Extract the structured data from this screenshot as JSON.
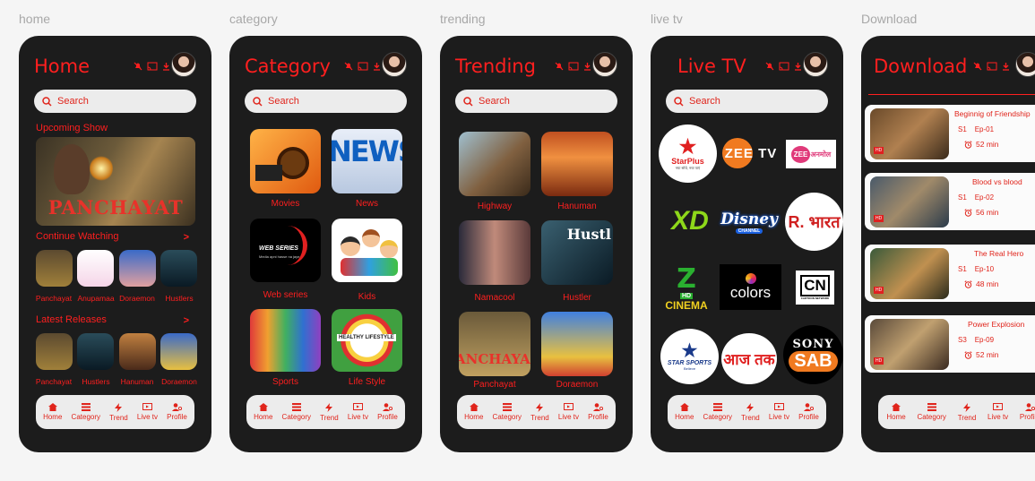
{
  "frames": [
    "home",
    "category",
    "trending",
    "live tv",
    "Download"
  ],
  "screens": {
    "home": {
      "title": "Home"
    },
    "category": {
      "title": "Category"
    },
    "trending": {
      "title": "Trending"
    },
    "livetv": {
      "title": "Live TV"
    },
    "download": {
      "title": "Download"
    }
  },
  "search": {
    "placeholder": "Search"
  },
  "home": {
    "upcoming_label": "Upcoming Show",
    "upcoming_banner_text": "PANCHAYAT",
    "continue_label": "Continue Watching",
    "continue_items": [
      "Panchayat",
      "Anupamaa",
      "Doraemon",
      "Hustlers"
    ],
    "latest_label": "Latest Releases",
    "latest_items": [
      "Panchayat",
      "Hustlers",
      "Hanuman",
      "Doraemon"
    ],
    "chevron": ">"
  },
  "category": {
    "items": [
      "Movies",
      "News",
      "Web series",
      "Kids",
      "Sports",
      "Life Style"
    ],
    "thumb_texts": {
      "news": "NEWS",
      "web": "WEB SERIES",
      "web_sub": "Media apni hasse na jaye",
      "life": "HEALTHY LIFESTYLE"
    }
  },
  "trending": {
    "items": [
      "Highway",
      "Hanuman",
      "Namacool",
      "Hustler",
      "Panchayat",
      "Doraemon"
    ],
    "thumb_texts": {
      "hustle": "Hustl",
      "panch": "ANCHAYA"
    }
  },
  "livetv": {
    "channels": {
      "starplus": "StarPlus",
      "starplus_tag": "नया सोचे, नया पाएं",
      "zeetv": "ZEE TV",
      "zee_a": "ZEE",
      "zee_b": "अनमोल",
      "xd": "XD",
      "disney": "Disney",
      "disney_sub": "CHANNEL",
      "bharat": "R. भारत",
      "zee_cinema_hd": "HD",
      "zee_cinema": "CINEMA",
      "colors": "colors",
      "cn": "CN",
      "cn_sub": "CARTOON NETWORK",
      "starsports": "STAR SPORTS",
      "starsports_sub": "Believe",
      "aajtak": "आज तक",
      "sony": "SONY",
      "sab": "SAB"
    }
  },
  "download": {
    "items": [
      {
        "title": "Beginnig of Friendship",
        "season": "S1",
        "episode": "Ep-01",
        "duration": "52 min"
      },
      {
        "title": "Blood vs blood",
        "season": "S1",
        "episode": "Ep-02",
        "duration": "56 min"
      },
      {
        "title": "The Real Hero",
        "season": "S1",
        "episode": "Ep-10",
        "duration": "48 min"
      },
      {
        "title": "Power  Explosion",
        "season": "S3",
        "episode": "Ep-09",
        "duration": "52 min"
      }
    ],
    "hd_badge": "HD"
  },
  "nav": [
    "Home",
    "Category",
    "Trend",
    "Live tv",
    "Profile"
  ],
  "colors": {
    "accent": "#ff1f1f",
    "phone_bg": "#1c1c1c",
    "bar_bg": "#ececec"
  }
}
